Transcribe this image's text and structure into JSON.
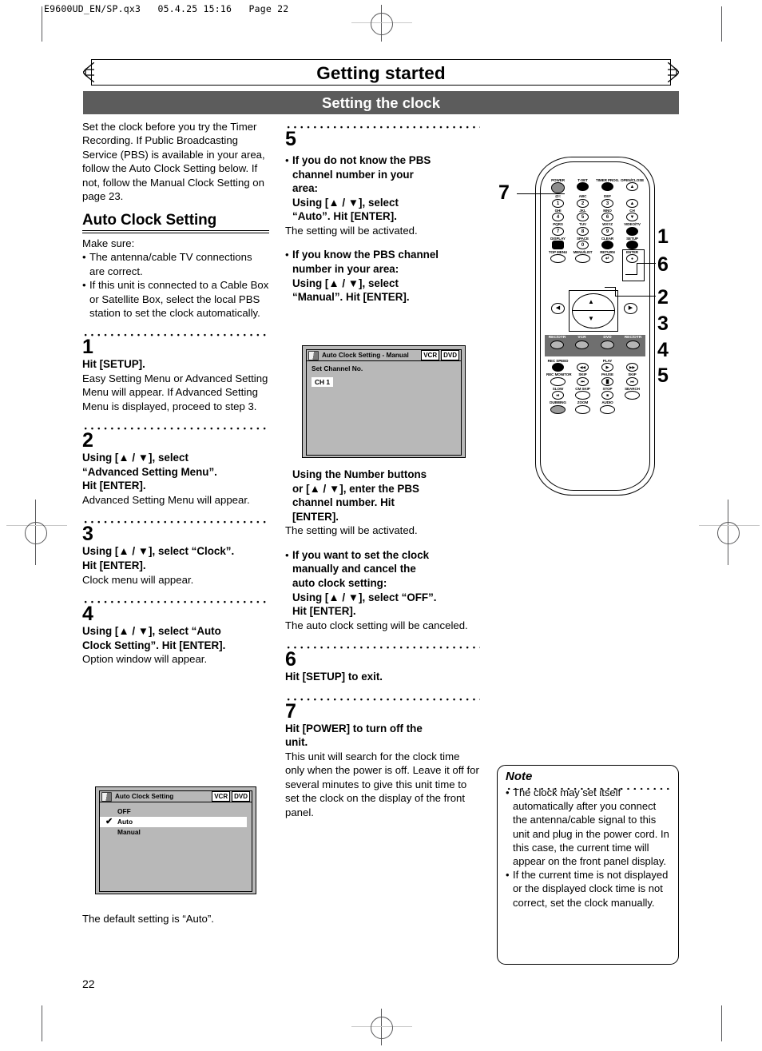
{
  "file_header": "E9600UD_EN/SP.qx3   05.4.25 15:16   Page 22",
  "title": "Getting started",
  "section": "Setting the clock",
  "page_number": "22",
  "left_column": {
    "intro": "Set the clock before you try the Timer Recording. If Public Broadcasting Service (PBS) is available in your area, follow the Auto Clock Setting below. If not, follow the Manual Clock Setting on page 23.",
    "subheading": "Auto Clock Setting",
    "make_sure_label": "Make sure:",
    "make_sure_items": [
      "The antenna/cable TV connections are correct.",
      "If this unit is connected to a Cable Box or Satellite Box, select the local PBS station to set the clock automatically."
    ],
    "steps": [
      {
        "number": "1",
        "head": "Hit [SETUP].",
        "body": "Easy Setting Menu or Advanced Setting Menu will appear. If Advanced Setting Menu is displayed, proceed to step 3."
      },
      {
        "number": "2",
        "head_line1": "Using [▲ / ▼], select",
        "head_line2": "“Advanced Setting Menu”.",
        "head_line3": "Hit [ENTER].",
        "body": "Advanced Setting Menu will appear."
      },
      {
        "number": "3",
        "head_line1": "Using [▲ / ▼], select “Clock”.",
        "head_line2": "Hit [ENTER].",
        "body": "Clock menu will appear."
      },
      {
        "number": "4",
        "head_line1": "Using [▲ / ▼], select “Auto",
        "head_line2": "Clock Setting”. Hit [ENTER].",
        "body": "Option window will appear."
      }
    ],
    "osd_auto": {
      "title": "Auto Clock Setting",
      "badges": [
        "VCR",
        "DVD"
      ],
      "options": [
        "OFF",
        "Auto",
        "Manual"
      ],
      "selected": "Auto",
      "check_glyph": "✔"
    },
    "default_note": "The default setting is “Auto”."
  },
  "mid_column": {
    "steps": [
      {
        "number": "5",
        "case1_head_l1": "If you do not know the PBS",
        "case1_head_l2": "channel number in your",
        "case1_head_l3": "area:",
        "case1_action_l1": "Using [▲ / ▼], select",
        "case1_action_l2": "“Auto”. Hit [ENTER].",
        "case1_body": "The setting will be activated.",
        "case2_head_l1": "If you know the PBS channel",
        "case2_head_l2": "number in your area:",
        "case2_action_l1": "Using [▲ / ▼], select",
        "case2_action_l2": "“Manual”. Hit [ENTER].",
        "case2_action2_l1": "Using the Number buttons",
        "case2_action2_l2": "or [▲ / ▼], enter the PBS",
        "case2_action2_l3": "channel number. Hit",
        "case2_action2_l4": "[ENTER].",
        "case2_body": "The setting will be activated.",
        "case3_head_l1": "If you want to set the clock",
        "case3_head_l2": "manually and cancel the",
        "case3_head_l3": "auto clock setting:",
        "case3_action_l1": "Using [▲ / ▼], select “OFF”.",
        "case3_action_l2": "Hit [ENTER].",
        "case3_body": "The auto clock setting will be canceled."
      },
      {
        "number": "6",
        "head": "Hit [SETUP] to exit."
      },
      {
        "number": "7",
        "head_l1": "Hit [POWER] to turn off the",
        "head_l2": "unit.",
        "body": "This unit will search for the clock time only when the power is off. Leave it off for several minutes to give this unit time to set the clock on the display of the front panel."
      }
    ],
    "osd_manual": {
      "title": "Auto Clock Setting - Manual",
      "badges": [
        "VCR",
        "DVD"
      ],
      "field_label": "Set Channel No.",
      "field_value": "CH 1"
    }
  },
  "note": {
    "title": "Note",
    "items": [
      "The clock may set itself automatically after you connect the antenna/cable signal to this unit and plug in the power cord. In this case, the current time will appear on the front panel display.",
      "If the current time is not displayed or the displayed clock time is not correct, set the clock manually."
    ]
  },
  "remote": {
    "callouts": [
      "1",
      "6",
      "2",
      "3",
      "4",
      "5",
      "7"
    ],
    "rows": [
      {
        "cells": [
          {
            "label": "POWER",
            "glyph": "",
            "style": "power"
          },
          {
            "label": "T-SET",
            "glyph": "",
            "style": "filled"
          },
          {
            "label": "TIMER PROG.",
            "glyph": "",
            "style": "filled"
          },
          {
            "label": "OPEN/CLOSE",
            "glyph": "▲",
            "style": "plain"
          }
        ]
      },
      {
        "cells": [
          {
            "label": "@!:",
            "glyph": "1",
            "style": "plain"
          },
          {
            "label": "ABC",
            "glyph": "2",
            "style": "plain"
          },
          {
            "label": "DEF",
            "glyph": "3",
            "style": "plain"
          },
          {
            "label": "",
            "glyph": "▲",
            "style": "plain"
          }
        ]
      },
      {
        "cells": [
          {
            "label": "GHI",
            "glyph": "4",
            "style": "plain"
          },
          {
            "label": "JKL",
            "glyph": "5",
            "style": "plain"
          },
          {
            "label": "MNO",
            "glyph": "6",
            "style": "plain"
          },
          {
            "label": "CH",
            "glyph": "▼",
            "style": "ch"
          }
        ]
      },
      {
        "cells": [
          {
            "label": "PQRS",
            "glyph": "7",
            "style": "plain"
          },
          {
            "label": "TUV",
            "glyph": "8",
            "style": "plain"
          },
          {
            "label": "WXYZ",
            "glyph": "9",
            "style": "plain"
          },
          {
            "label": "VIDEO/TV",
            "glyph": "",
            "style": "filled"
          }
        ]
      },
      {
        "cells": [
          {
            "label": "DISPLAY",
            "glyph": "■",
            "style": "filled"
          },
          {
            "label": "SPACE",
            "glyph": "0",
            "style": "plain"
          },
          {
            "label": "CLEAR",
            "glyph": "",
            "style": "filled"
          },
          {
            "label": "SETUP",
            "glyph": "",
            "style": "filled"
          }
        ]
      },
      {
        "cells": [
          {
            "label": "TOP MENU",
            "glyph": "",
            "style": "plain"
          },
          {
            "label": "MENU/LIST",
            "glyph": "",
            "style": "plain"
          },
          {
            "label": "RETURN",
            "glyph": "↵",
            "style": "plain"
          },
          {
            "label": "ENTER",
            "glyph": "●",
            "style": "plain"
          }
        ]
      }
    ],
    "mode_band": [
      {
        "label": "REC/OTR"
      },
      {
        "label": "VCR"
      },
      {
        "label": "DVD"
      },
      {
        "label": "REC/OTR"
      }
    ],
    "transport_rows": [
      {
        "cells": [
          {
            "label": "REC SPEED",
            "glyph": "",
            "style": "filled"
          },
          {
            "label": "",
            "glyph": "◀◀",
            "style": "plain"
          },
          {
            "label": "PLAY",
            "glyph": "▶",
            "style": "plain"
          },
          {
            "label": "",
            "glyph": "▶▶",
            "style": "plain"
          }
        ]
      },
      {
        "cells": [
          {
            "label": "REC MONITOR",
            "glyph": "",
            "style": "plain"
          },
          {
            "label": "SKIP",
            "glyph": "⏮",
            "style": "plain"
          },
          {
            "label": "PAUSE",
            "glyph": "▐▌",
            "style": "plain"
          },
          {
            "label": "SKIP",
            "glyph": "⏭",
            "style": "plain"
          }
        ]
      },
      {
        "cells": [
          {
            "label": "SLOW",
            "glyph": "⏯",
            "style": "plain"
          },
          {
            "label": "CM SKIP",
            "glyph": "",
            "style": "plain"
          },
          {
            "label": "STOP",
            "glyph": "■",
            "style": "plain"
          },
          {
            "label": "SEARCH",
            "glyph": "",
            "style": "plain"
          }
        ]
      },
      {
        "cells": [
          {
            "label": "DUBBING",
            "glyph": "",
            "style": "gray"
          },
          {
            "label": "ZOOM",
            "glyph": "",
            "style": "plain"
          },
          {
            "label": "AUDIO",
            "glyph": "",
            "style": "plain"
          }
        ]
      }
    ]
  }
}
